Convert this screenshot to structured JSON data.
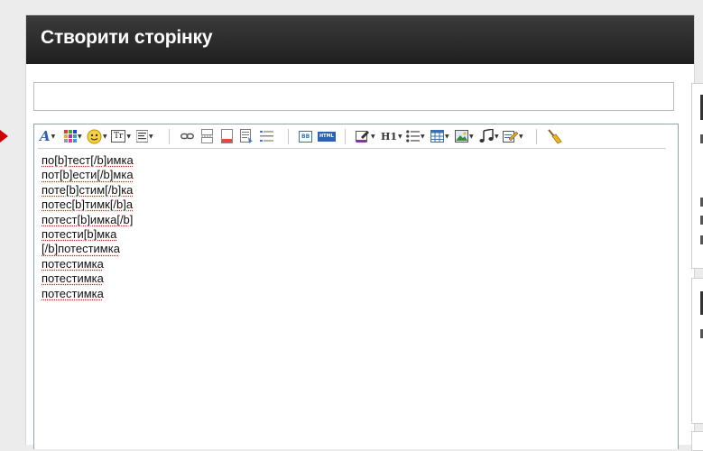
{
  "header": {
    "title": "Створити сторінку"
  },
  "title_field": {
    "value": "",
    "placeholder": ""
  },
  "editor": {
    "toolbar": [
      {
        "name": "font-color-icon",
        "label": "A",
        "dropdown": true
      },
      {
        "name": "color-grid-icon",
        "label": "",
        "dropdown": true
      },
      {
        "name": "smiley-icon",
        "label": "",
        "dropdown": true
      },
      {
        "name": "font-size-icon",
        "label": "Tr",
        "dropdown": true
      },
      {
        "name": "align-icon",
        "label": "",
        "dropdown": true
      },
      {
        "name": "link-icon",
        "label": ""
      },
      {
        "name": "page-break-icon",
        "label": ""
      },
      {
        "name": "document-icon",
        "label": ""
      },
      {
        "name": "spoiler-icon",
        "label": ""
      },
      {
        "name": "list-ruler-icon",
        "label": ""
      },
      {
        "name": "bbcode-icon",
        "label": "BB"
      },
      {
        "name": "html-icon",
        "label": "HTML"
      },
      {
        "name": "highlight-icon",
        "label": "",
        "dropdown": true
      },
      {
        "name": "heading-icon",
        "label": "H1",
        "dropdown": true
      },
      {
        "name": "bullet-list-icon",
        "label": "",
        "dropdown": true
      },
      {
        "name": "table-icon",
        "label": "",
        "dropdown": true
      },
      {
        "name": "image-icon",
        "label": "",
        "dropdown": true
      },
      {
        "name": "music-icon",
        "label": "",
        "dropdown": true
      },
      {
        "name": "edit-icon",
        "label": "",
        "dropdown": true
      },
      {
        "name": "clean-broom-icon",
        "label": ""
      }
    ],
    "lines": [
      "по[b]тест[/b]имка",
      "пот[b]ести[/b]мка",
      "поте[b]стим[/b]ка",
      "потес[b]тимк[/b]а",
      "потест[b]имка[/b]",
      "потести[b]мка",
      "[/b]потестимка",
      "потестимка",
      "потестимка",
      "потестимка"
    ]
  },
  "colors": {
    "header_bg": "#2a2a2a",
    "accent": "#d00000",
    "editor_border": "#8aa4bb",
    "spell_underline": "#e02020"
  }
}
